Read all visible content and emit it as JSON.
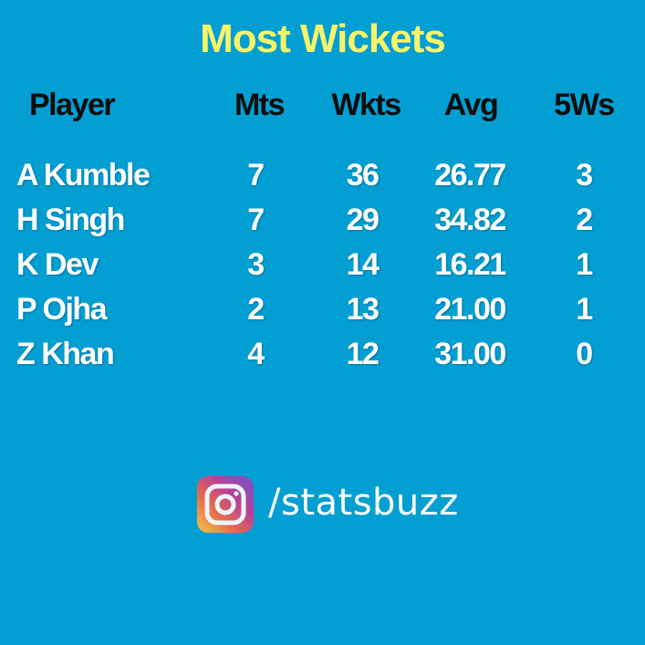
{
  "title": "Most Wickets",
  "table": {
    "headers": [
      "Player",
      "Mts",
      "Wkts",
      "Avg",
      "5Ws"
    ],
    "rows": [
      [
        "A Kumble",
        "7",
        "36",
        "26.77",
        "3"
      ],
      [
        "H Singh",
        "7",
        "29",
        "34.82",
        "2"
      ],
      [
        "K Dev",
        "3",
        "14",
        "16.21",
        "1"
      ],
      [
        "P Ojha",
        "2",
        "13",
        "21.00",
        "1"
      ],
      [
        "Z Khan",
        "4",
        "12",
        "31.00",
        "0"
      ]
    ]
  },
  "footer": {
    "icon": "instagram-icon",
    "handle": "/statsbuzz"
  },
  "colors": {
    "background": "#039fd2",
    "title": "#f7f46a",
    "header_text": "#0d0d0d",
    "cell_text": "#ffffff"
  }
}
